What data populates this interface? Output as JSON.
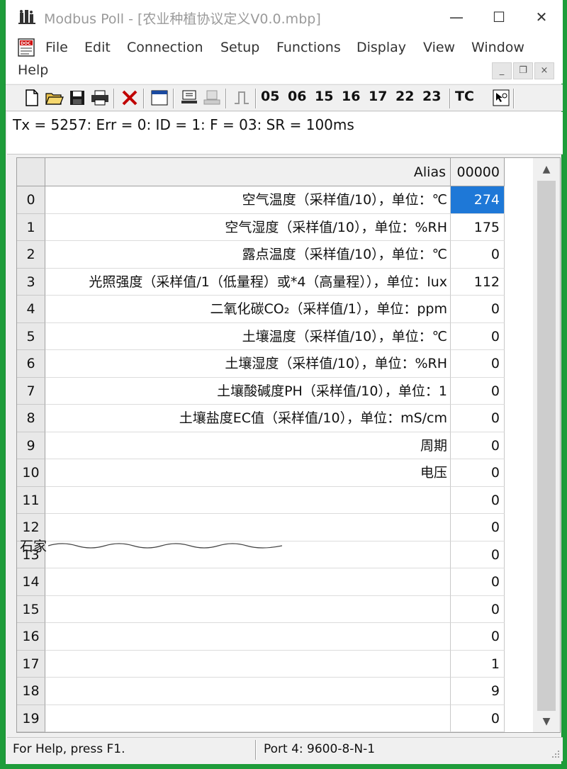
{
  "window": {
    "title": "Modbus Poll - [农业种植协议定义V0.0.mbp]",
    "minimize_glyph": "—",
    "maximize_glyph": "☐",
    "close_glyph": "✕"
  },
  "menu": {
    "items": [
      "File",
      "Edit",
      "Connection",
      "Setup",
      "Functions",
      "Display",
      "View",
      "Window",
      "Help"
    ],
    "mdi_minimize": "_",
    "mdi_restore": "❐",
    "mdi_close": "×"
  },
  "toolbar": {
    "function_buttons": [
      "05",
      "06",
      "15",
      "16",
      "17",
      "22",
      "23",
      "TC"
    ]
  },
  "status_line": "Tx = 5257: Err = 0: ID = 1: F = 03: SR = 100ms",
  "grid": {
    "alias_header": "Alias",
    "value_header": "00000",
    "rows": [
      {
        "num": "0",
        "alias": "空气温度（采样值/10），单位：℃",
        "value": "274"
      },
      {
        "num": "1",
        "alias": "空气湿度（采样值/10），单位：%RH",
        "value": "175"
      },
      {
        "num": "2",
        "alias": "露点温度（采样值/10），单位：℃",
        "value": "0"
      },
      {
        "num": "3",
        "alias": "光照强度（采样值/1（低量程）或*4（高量程）），单位：lux",
        "value": "112"
      },
      {
        "num": "4",
        "alias": "二氧化碳CO₂（采样值/1），单位：ppm",
        "value": "0"
      },
      {
        "num": "5",
        "alias": "土壤温度（采样值/10），单位：℃",
        "value": "0"
      },
      {
        "num": "6",
        "alias": "土壤湿度（采样值/10），单位：%RH",
        "value": "0"
      },
      {
        "num": "7",
        "alias": "土壤酸碱度PH（采样值/10），单位：1",
        "value": "0"
      },
      {
        "num": "8",
        "alias": "土壤盐度EC值（采样值/10），单位：mS/cm",
        "value": "0"
      },
      {
        "num": "9",
        "alias": "周期",
        "value": "0"
      },
      {
        "num": "10",
        "alias": "电压",
        "value": "0"
      },
      {
        "num": "11",
        "alias": "",
        "value": "0"
      },
      {
        "num": "12",
        "alias": "",
        "value": "0"
      },
      {
        "num": "13",
        "alias": "",
        "value": "0"
      },
      {
        "num": "14",
        "alias": "",
        "value": "0"
      },
      {
        "num": "15",
        "alias": "",
        "value": "0"
      },
      {
        "num": "16",
        "alias": "",
        "value": "0"
      },
      {
        "num": "17",
        "alias": "",
        "value": "1"
      },
      {
        "num": "18",
        "alias": "",
        "value": "9"
      },
      {
        "num": "19",
        "alias": "",
        "value": "0"
      }
    ],
    "selected_row": 0
  },
  "watermark_text": "石家",
  "bottom_status": {
    "help": "For Help, press F1.",
    "port": "Port 4: 9600-8-N-1"
  },
  "colors": {
    "desktop_green": "#1e9c3a",
    "selection_blue": "#1e78d7",
    "title_gray": "#9a9a9a"
  }
}
